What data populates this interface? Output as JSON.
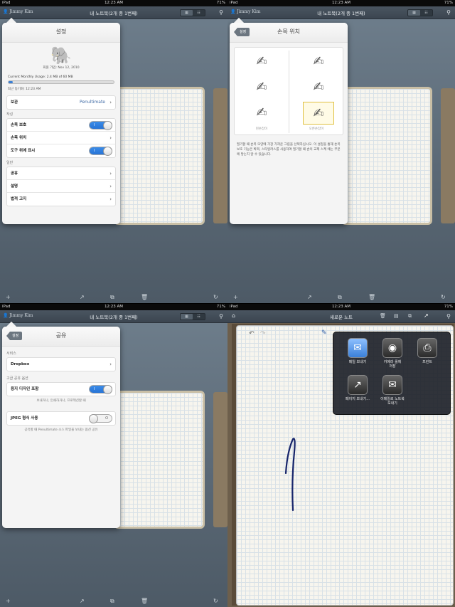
{
  "status": {
    "device": "iPad",
    "wifi": "WiFi",
    "time": "12:23 AM",
    "battery": "71%"
  },
  "nav": {
    "user": "Jimmy Kim",
    "title": "내 노트북(2개 중 1번째)",
    "new_note_title": "새로운 노트"
  },
  "settings": {
    "title": "설정",
    "member_since": "회원 가입: Nov 12, 2010",
    "usage": "Current Monthly Usage: 2.4 MB of 60 MB",
    "usage_fraction": 0.04,
    "last_sync": "최근 동기화: 12:23 AM",
    "storage_label": "보관",
    "storage_value": "Penultimate",
    "section_write": "작성",
    "palm_protect": "손목 보호",
    "palm_position": "손목 위치",
    "tools_on_top": "도구 위에 표시",
    "section_general": "일반",
    "general_share": "공유",
    "general_help": "설명",
    "general_legal": "법적 고지",
    "toggle_on": "I",
    "toggle_off": "O"
  },
  "wrist": {
    "back": "설정",
    "title": "손목 위치",
    "left_caption": "왼손잡이",
    "right_caption": "오른손잡이",
    "description": "필기할 때 손목 모양에 가장 가까운 그림을 선택하십시오. 이 설정을 통해 손목 보호 기능은 획력, 스타일러스를 사용하여 필기할 때 손이 교제 스케 에는 부분에 닿는지 알 수 있습니다."
  },
  "sharing": {
    "back": "설정",
    "title": "공유",
    "section_service": "서비스",
    "dropbox": "Dropbox",
    "section_advanced": "고급 공유 옵션",
    "paper_design": "용지 디자인 포함",
    "paper_note": "보내거나, 인쇄하거나, 프로젝션할 때",
    "jpeg": "JPEG 형식 사용",
    "jpeg_note": "공유할 때 Penultimate 소스 파일을 보내는 옵션 공유"
  },
  "share_menu": {
    "email": "메일 보내기",
    "camera": "카메라 롤에\n저장",
    "print": "프린트",
    "send_page": "페이지 보내기...",
    "evernote": "이메일로 노트북\n보내기"
  }
}
